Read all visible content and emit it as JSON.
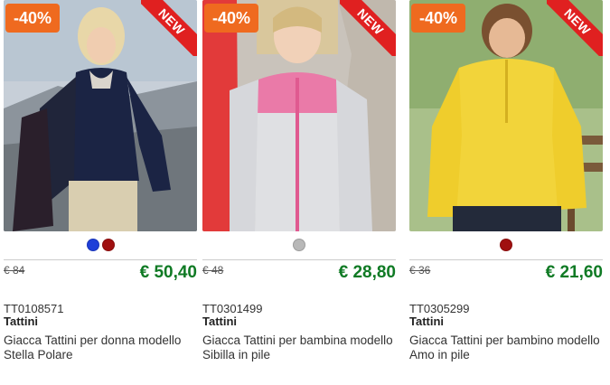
{
  "products": [
    {
      "discount": "-40%",
      "badge": "NEW",
      "swatches": [
        "#1f3fd8",
        "#a01010"
      ],
      "old_price": "€ 84",
      "price": "€ 50,40",
      "sku": "TT0108571",
      "brand": "Tattini",
      "title": "Giacca Tattini per donna modello Stella Polare"
    },
    {
      "discount": "-40%",
      "badge": "NEW",
      "swatches": [
        "#b8b8b8"
      ],
      "old_price": "€ 48",
      "price": "€ 28,80",
      "sku": "TT0301499",
      "brand": "Tattini",
      "title": "Giacca Tattini per bambina modello Sibilla in pile"
    },
    {
      "discount": "-40%",
      "badge": "NEW",
      "swatches": [
        "#a01010"
      ],
      "old_price": "€ 36",
      "price": "€ 21,60",
      "sku": "TT0305299",
      "brand": "Tattini",
      "title": "Giacca Tattini per bambino modello Amo in pile"
    }
  ],
  "colors": {
    "discount_bg": "#ef6a1f",
    "ribbon_bg": "#e02020",
    "price_green": "#0f7a24"
  }
}
